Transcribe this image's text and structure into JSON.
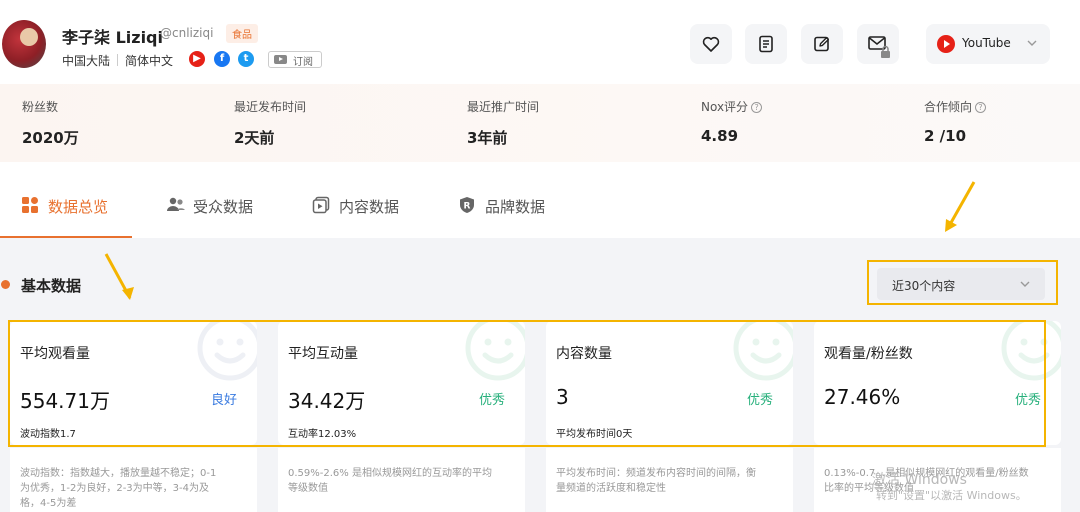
{
  "profile": {
    "name": "李子柒 Liziqi",
    "handle": "@cnliziqi",
    "category_tag": "食品",
    "region": "中国大陆",
    "language": "简体中文",
    "subscribe_label": "订阅"
  },
  "platform_select": {
    "label": "YouTube"
  },
  "stats": [
    {
      "label": "粉丝数",
      "value": "2020万",
      "help": false
    },
    {
      "label": "最近发布时间",
      "value": "2天前",
      "help": false
    },
    {
      "label": "最近推广时间",
      "value": "3年前",
      "help": false
    },
    {
      "label": "Nox评分",
      "value": "4.89",
      "help": true
    },
    {
      "label": "合作倾向",
      "value": "2 /10",
      "help": true
    }
  ],
  "tabs": [
    {
      "label": "数据总览",
      "active": true
    },
    {
      "label": "受众数据",
      "active": false
    },
    {
      "label": "内容数据",
      "active": false
    },
    {
      "label": "品牌数据",
      "active": false
    }
  ],
  "section": {
    "title": "基本数据",
    "range_label": "近30个内容"
  },
  "cards": [
    {
      "title": "平均观看量",
      "value": "554.71万",
      "badge": "良好",
      "badge_type": "good",
      "sub": "波动指数1.7",
      "desc": "波动指数：指数越大，播放量越不稳定；0-1为优秀，1-2为良好，2-3为中等，3-4为及格，4-5为差"
    },
    {
      "title": "平均互动量",
      "value": "34.42万",
      "badge": "优秀",
      "badge_type": "excellent",
      "sub": "互动率12.03%",
      "desc": "0.59%-2.6% 是相似规模网红的互动率的平均等级数值"
    },
    {
      "title": "内容数量",
      "value": "3",
      "badge": "优秀",
      "badge_type": "excellent",
      "sub": "平均发布时间0天",
      "desc": "平均发布时间：频道发布内容时间的间隔，衡量频道的活跃度和稳定性"
    },
    {
      "title": "观看量/粉丝数",
      "value": "27.46%",
      "badge": "优秀",
      "badge_type": "excellent",
      "sub": "",
      "desc": "0.13%-0.7…是相似规模网红的观看量/粉丝数比率的平均等级数值"
    }
  ],
  "watermark": {
    "line1": "激活 Windows",
    "line2": "转到\"设置\"以激活 Windows。"
  },
  "colors": {
    "accent": "#e8712f",
    "highlight": "#f4b400",
    "good": "#3a7be0",
    "excellent": "#28b07c"
  }
}
